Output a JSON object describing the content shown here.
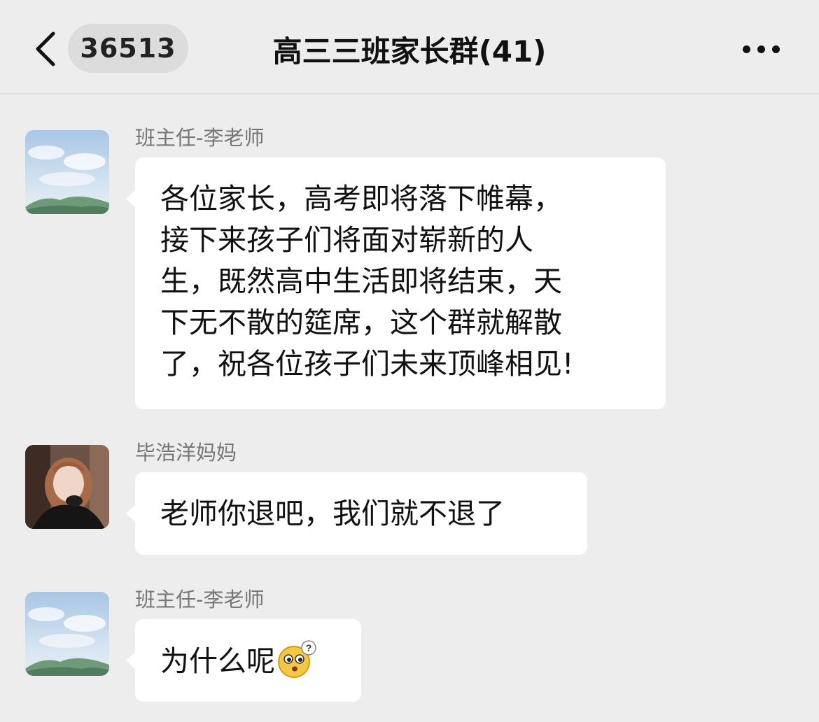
{
  "header": {
    "back_label": "<",
    "unread_count": "36513",
    "title": "高三三班家长群(41)"
  },
  "messages": [
    {
      "sender": "班主任-李老师",
      "avatar": "sky-landscape-avatar",
      "lines": [
        "各位家长，高考即将落下帷幕，",
        "接下来孩子们将面对崭新的人",
        "生，既然高中生活即将结束，天",
        "下无不散的筵席，这个群就解散",
        "了，祝各位孩子们未来顶峰相见!"
      ]
    },
    {
      "sender": "毕浩洋妈妈",
      "avatar": "woman-portrait-avatar",
      "text": "老师你退吧，我们就不退了"
    },
    {
      "sender": "班主任-李老师",
      "avatar": "sky-landscape-avatar",
      "text": "为什么呢",
      "emoji": "confused-face-emoji"
    }
  ]
}
